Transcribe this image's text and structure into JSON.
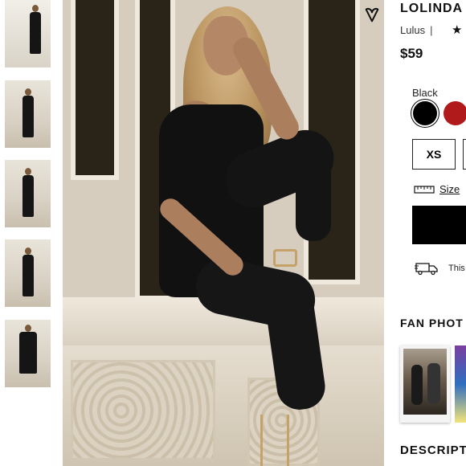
{
  "product": {
    "title": "LOLINDA",
    "brand": "Lulus",
    "brand_separator": "|",
    "rating_stars": "★",
    "price": "$59"
  },
  "options": {
    "color_label": "Black",
    "colors": [
      {
        "name": "Black",
        "hex": "#000000",
        "selected": true
      },
      {
        "name": "Red",
        "hex": "#b01a1a",
        "selected": false
      }
    ],
    "sizes": [
      "XS"
    ],
    "size_guide_label": "Size"
  },
  "shipping": {
    "text": "This"
  },
  "sections": {
    "fan_photos_heading": "FAN PHOT",
    "description_heading": "DESCRIPT"
  },
  "icons": {
    "wishlist": "heart-icon",
    "size_guide": "ruler-icon",
    "shipping": "truck-icon"
  },
  "thumbnails_count": 5
}
